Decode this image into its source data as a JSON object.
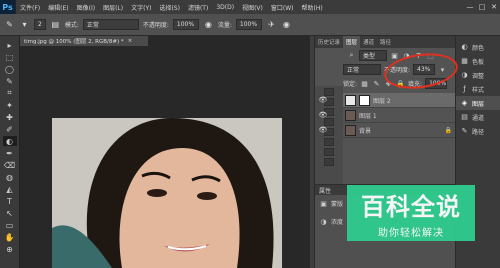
{
  "menu": {
    "logo": "Ps",
    "items": [
      "文件(F)",
      "编辑(E)",
      "图像(I)",
      "图层(L)",
      "文字(Y)",
      "选择(S)",
      "滤镜(T)",
      "3D(D)",
      "视图(V)",
      "窗口(W)",
      "帮助(H)"
    ],
    "minimize": "—",
    "maximize": "□",
    "close": "✕"
  },
  "options": {
    "brush_size": "2",
    "mode_label": "模式:",
    "mode_value": "正常",
    "opacity_label": "不透明度:",
    "opacity_value": "100%",
    "flow_label": "流量:",
    "flow_value": "100%"
  },
  "document": {
    "tab_title": "timg.jpg @ 100% (图层 2, RGB/8#) *",
    "close": "×"
  },
  "tools": [
    "▸",
    "⬚",
    "◯",
    "✎",
    "⌗",
    "✦",
    "✚",
    "✐",
    "◐",
    "✒",
    "⌫",
    "◍",
    "◭",
    "T",
    "↖",
    "▭",
    "✋",
    "⊕"
  ],
  "panel_tabs": [
    "历史记录",
    "图层",
    "通道",
    "路径"
  ],
  "layers": {
    "kind_label": "类型",
    "blend_mode": "正常",
    "opacity_label": "不透明度:",
    "opacity_value": "43%",
    "lock_label": "锁定:",
    "fill_label": "填充:",
    "fill_value": "100%",
    "items": [
      {
        "name": "图层 2",
        "selected": true
      },
      {
        "name": "图层 1",
        "selected": false
      },
      {
        "name": "背景",
        "selected": false
      }
    ],
    "lock_icon": "🔒"
  },
  "properties": {
    "title": "属性",
    "row1": "蒙版",
    "row2": "浓度"
  },
  "side_panel": {
    "items": [
      "颜色",
      "色板",
      "调整",
      "样式",
      "图层",
      "通道",
      "路径"
    ]
  },
  "watermark": {
    "title": "百科全说",
    "subtitle": "助你轻松解决"
  },
  "colors": {
    "annotation": "#e1301f",
    "watermark_bg": "#2ecc8f"
  }
}
